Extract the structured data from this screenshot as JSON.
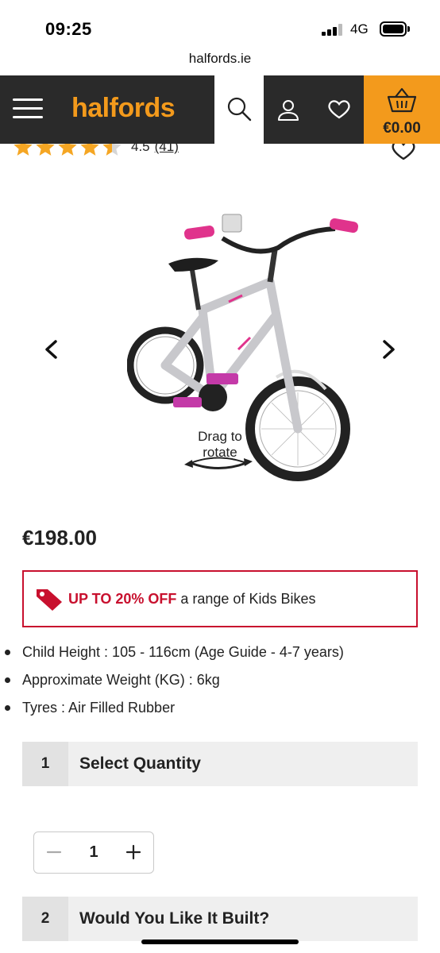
{
  "status_bar": {
    "time": "09:25",
    "network": "4G"
  },
  "browser": {
    "url": "halfords.ie"
  },
  "header": {
    "logo": "halfords",
    "basket_total": "€0.00",
    "brand_color": "#f39a1c",
    "dark_color": "#2a2a2a"
  },
  "rating": {
    "value": "4.5",
    "count": "(41)",
    "stars": 4.5
  },
  "gallery": {
    "drag_hint": "Drag to rotate"
  },
  "product": {
    "price": "€198.00"
  },
  "promo": {
    "bold": "UP TO 20% OFF",
    "text": "a range of Kids Bikes",
    "accent": "#c8102e"
  },
  "features": [
    "Child Height : 105 - 116cm (Age Guide - 4-7 years)",
    "Approximate Weight (KG) : 6kg",
    "Tyres : Air Filled Rubber"
  ],
  "steps": [
    {
      "number": "1",
      "title": "Select Quantity"
    },
    {
      "number": "2",
      "title": "Would You Like It Built?"
    }
  ],
  "quantity": {
    "value": "1"
  }
}
